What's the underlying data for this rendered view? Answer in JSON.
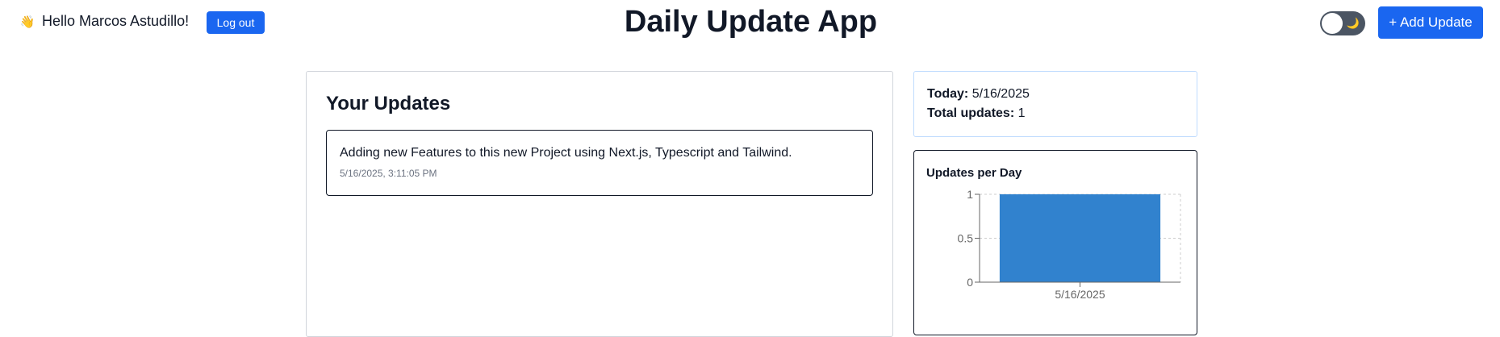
{
  "header": {
    "wave_icon": "👋",
    "greeting": "Hello Marcos Astudillo!",
    "logout_label": "Log out",
    "title": "Daily Update App",
    "moon_icon": "🌙",
    "add_update_label": "+ Add Update",
    "theme_toggle_state": "off"
  },
  "updates": {
    "heading": "Your Updates",
    "items": [
      {
        "text": "Adding new Features to this new Project using Next.js, Typescript and Tailwind.",
        "timestamp": "5/16/2025, 3:11:05 PM"
      }
    ]
  },
  "stats": {
    "today_label": "Today:",
    "today_value": "5/16/2025",
    "total_label": "Total updates:",
    "total_value": "1"
  },
  "colors": {
    "accent": "#1a66f0",
    "bar": "#3182ce",
    "toggle_track": "#4b5563"
  },
  "chart_data": {
    "type": "bar",
    "title": "Updates per Day",
    "categories": [
      "5/16/2025"
    ],
    "values": [
      1
    ],
    "ylim": [
      0,
      1
    ],
    "yticks": [
      "0",
      "0.5",
      "1"
    ],
    "xlabel": "",
    "ylabel": "",
    "grid": true
  }
}
